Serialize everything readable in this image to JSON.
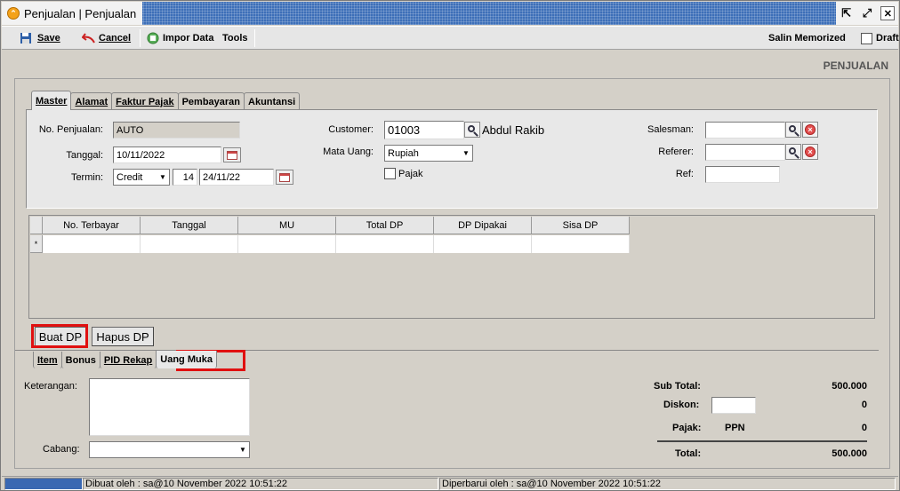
{
  "window": {
    "title": "Penjualan | Penjualan"
  },
  "toolbar": {
    "save": "Save",
    "cancel": "Cancel",
    "impor": "Impor Data",
    "tools": "Tools",
    "salin": "Salin Memorized",
    "draft": "Draft"
  },
  "header": {
    "section": "PENJUALAN"
  },
  "tabs": [
    {
      "label": "Master",
      "active": true
    },
    {
      "label": "Alamat"
    },
    {
      "label": "Faktur Pajak"
    },
    {
      "label": "Pembayaran"
    },
    {
      "label": "Akuntansi"
    }
  ],
  "master": {
    "no_penjualan_label": "No. Penjualan:",
    "no_penjualan": "AUTO",
    "tanggal_label": "Tanggal:",
    "tanggal": "10/11/2022",
    "termin_label": "Termin:",
    "termin": "Credit",
    "termin_days": "14",
    "termin_date": "24/11/22",
    "customer_label": "Customer:",
    "customer_code": "01003",
    "customer_name": "Abdul Rakib",
    "mata_uang_label": "Mata Uang:",
    "mata_uang": "Rupiah",
    "pajak_label": "Pajak",
    "salesman_label": "Salesman:",
    "salesman": "",
    "referer_label": "Referer:",
    "referer": "",
    "ref_label": "Ref:",
    "ref": ""
  },
  "dp_table": {
    "columns": [
      "No. Terbayar",
      "Tanggal",
      "MU",
      "Total DP",
      "DP Dipakai",
      "Sisa DP"
    ],
    "new_row_marker": "*"
  },
  "buttons": {
    "buat_dp": "Buat DP",
    "hapus_dp": "Hapus DP"
  },
  "bottom_tabs": [
    {
      "label": "Item"
    },
    {
      "label": "Bonus"
    },
    {
      "label": "PID Rekap"
    },
    {
      "label": "Uang Muka",
      "active": true
    }
  ],
  "footer": {
    "keterangan_label": "Keterangan:",
    "keterangan": "",
    "cabang_label": "Cabang:",
    "cabang": "",
    "subtotal_label": "Sub Total:",
    "subtotal": "500.000",
    "diskon_label": "Diskon:",
    "diskon_value": "0",
    "pajak_label": "Pajak:",
    "pajak_name": "PPN",
    "pajak_value": "0",
    "total_label": "Total:",
    "total": "500.000"
  },
  "statusbar": {
    "dibuat": "Dibuat oleh : sa@10 November 2022  10:51:22",
    "diperbarui": "Diperbarui oleh : sa@10 November 2022  10:51:22"
  },
  "colors": {
    "highlight": "#e01010",
    "titlebar": "#3d6fb8",
    "status_accent": "#3a68b2"
  }
}
